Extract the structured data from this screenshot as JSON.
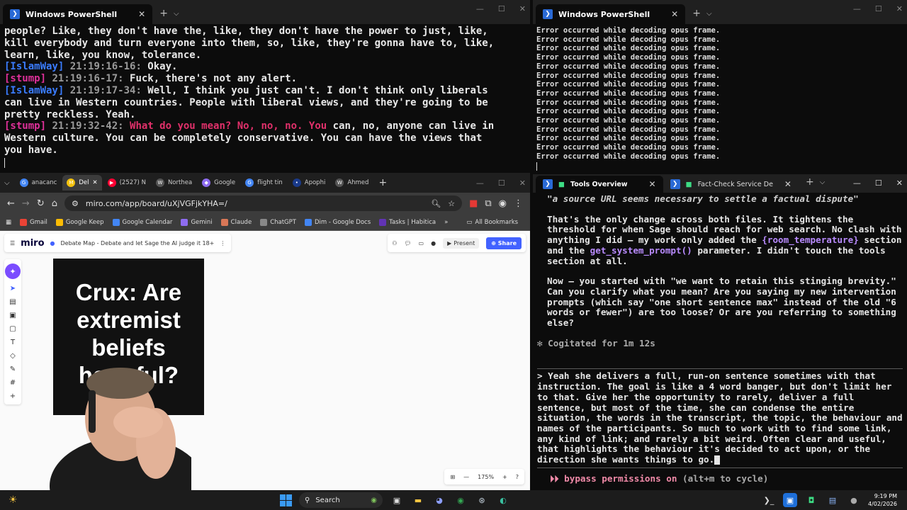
{
  "terminal_left": {
    "tab_title": "Windows PowerShell",
    "lines": [
      {
        "segments": [
          {
            "t": "people? Like, they don't have the, like, they don't have the power to just, like,",
            "c": ""
          }
        ]
      },
      {
        "segments": [
          {
            "t": "kill everybody and turn everyone into them, so, like, they're gonna have to, like,",
            "c": ""
          }
        ]
      },
      {
        "segments": [
          {
            "t": "learn, like, you know, tolerance.",
            "c": ""
          }
        ]
      },
      {
        "segments": [
          {
            "t": "[IslamWay]",
            "c": "spk-islam"
          },
          {
            "t": " 21:19:16-16:",
            "c": "ts"
          },
          {
            "t": " Okay.",
            "c": ""
          }
        ]
      },
      {
        "segments": [
          {
            "t": "[stump]",
            "c": "spk-stump"
          },
          {
            "t": " 21:19:16-17:",
            "c": "ts"
          },
          {
            "t": " Fuck, there's not any alert.",
            "c": ""
          }
        ]
      },
      {
        "segments": [
          {
            "t": "[IslamWay]",
            "c": "spk-islam"
          },
          {
            "t": " 21:19:17-34:",
            "c": "ts"
          },
          {
            "t": " Well, I think you just can't. I don't think only liberals",
            "c": ""
          }
        ]
      },
      {
        "segments": [
          {
            "t": "can live in Western countries. People with liberal views, and they're going to be",
            "c": ""
          }
        ]
      },
      {
        "segments": [
          {
            "t": "pretty reckless. Yeah.",
            "c": ""
          }
        ]
      },
      {
        "segments": [
          {
            "t": "[stump]",
            "c": "spk-stump"
          },
          {
            "t": " 21:19:32-42:",
            "c": "ts"
          },
          {
            "t": " What do you mean? No, no, no. You",
            "c": "pink"
          },
          {
            "t": " can, no, anyone can live in",
            "c": ""
          }
        ]
      },
      {
        "segments": [
          {
            "t": "Western culture. You can be completely conservative. You can have the views that",
            "c": ""
          }
        ]
      },
      {
        "segments": [
          {
            "t": "you have.",
            "c": ""
          }
        ]
      }
    ]
  },
  "terminal_right": {
    "tab_title": "Windows PowerShell",
    "error_line": "Error occurred while decoding opus frame.",
    "error_count": 15
  },
  "browser": {
    "tabs": [
      {
        "label": "anacanc",
        "color": "#4285f4",
        "glyph": "G"
      },
      {
        "label": "Del",
        "color": "#f4c20d",
        "glyph": "M",
        "active": true
      },
      {
        "label": "(2527) N",
        "color": "#ff0033",
        "glyph": "▶"
      },
      {
        "label": "Northea",
        "color": "#555555",
        "glyph": "W"
      },
      {
        "label": "Google",
        "color": "#8e6cf0",
        "glyph": "◆"
      },
      {
        "label": "flight tin",
        "color": "#4285f4",
        "glyph": "G"
      },
      {
        "label": "Apophi",
        "color": "#1a3a8a",
        "glyph": "•"
      },
      {
        "label": "Ahmed",
        "color": "#555555",
        "glyph": "W"
      }
    ],
    "url": "miro.com/app/board/uXjVGFjkYHA=/",
    "bookmarks": [
      {
        "label": "Gmail",
        "color": "#ea4335"
      },
      {
        "label": "Google Keep",
        "color": "#fbbc04"
      },
      {
        "label": "Google Calendar",
        "color": "#4285f4"
      },
      {
        "label": "Gemini",
        "color": "#8e6cf0"
      },
      {
        "label": "Claude",
        "color": "#d97757"
      },
      {
        "label": "ChatGPT",
        "color": "#888888"
      },
      {
        "label": "Dim - Google Docs",
        "color": "#4285f4"
      },
      {
        "label": "Tasks | Habitica",
        "color": "#6133b4"
      }
    ],
    "all_bookmarks": "All Bookmarks",
    "miro": {
      "logo": "miro",
      "board_title": "Debate Map - Debate and let Sage the AI judge it 18+",
      "present": "Present",
      "share": "Share",
      "card_text": "Crux: Are extremist beliefs harmful?",
      "zoom": "175%"
    }
  },
  "claude_terminal": {
    "tab1": "Tools Overview",
    "tab2": "Fact-Check Service De",
    "quote_line": "\"a source URL seems necessary to settle a factual dispute\"",
    "para1_a": "That's the only change across both files. It tightens the threshold for when Sage should reach for web search. No clash with anything I did — my work only added the ",
    "code1": "{room_temperature}",
    "para1_b": " section and the ",
    "code2": "get_system_prompt()",
    "para1_c": " parameter. I didn't touch the tools section at all.",
    "para2": "Now — you started with \"we want to retain this stinging brevity.\" Can you clarify what you mean? Are you saying my new intervention prompts (which say \"one short sentence max\" instead of the old \"6 words or fewer\") are too loose? Or are you referring to something else?",
    "cogitated": "✻ Cogitated for 1m 12s",
    "user_prompt": "> Yeah she delivers a full, run-on sentence sometimes with that instruction. The goal is like a 4 word banger, but don't limit her to that. Give her the opportunity to rarely, deliver a full sentence, but most of the time, she can condense the entire situation, the words in the transcript, the topic, the behaviour and names of the participants. So much to work with to find some link, any kind of link; and rarely a bit weird. Often clear and useful, that highlights the behaviour it's decided to act upon, or the direction she wants things to go.",
    "bypass_label": "⏵⏵ bypass permissions on",
    "bypass_hint": " (alt+m to cycle)"
  },
  "taskbar": {
    "search": "Search",
    "time": "9:19 PM",
    "date": "4/02/2026"
  }
}
